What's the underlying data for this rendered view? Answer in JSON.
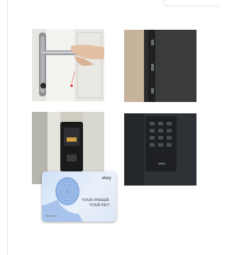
{
  "gallery": {
    "items": [
      {
        "subject": "door handle with fingerprint sensor"
      },
      {
        "subject": "door edge with locking mechanism"
      },
      {
        "subject": "fingerprint reader on door frame"
      },
      {
        "subject": "keypad on dark door"
      }
    ]
  },
  "card": {
    "brand": "ekey",
    "tagline_line1": "YOUR FINGER.",
    "tagline_line2": "YOUR KEY.",
    "small_print": "ekey.net"
  },
  "colors": {
    "accent": "#e31b23",
    "frame": "#e6e6e6"
  }
}
